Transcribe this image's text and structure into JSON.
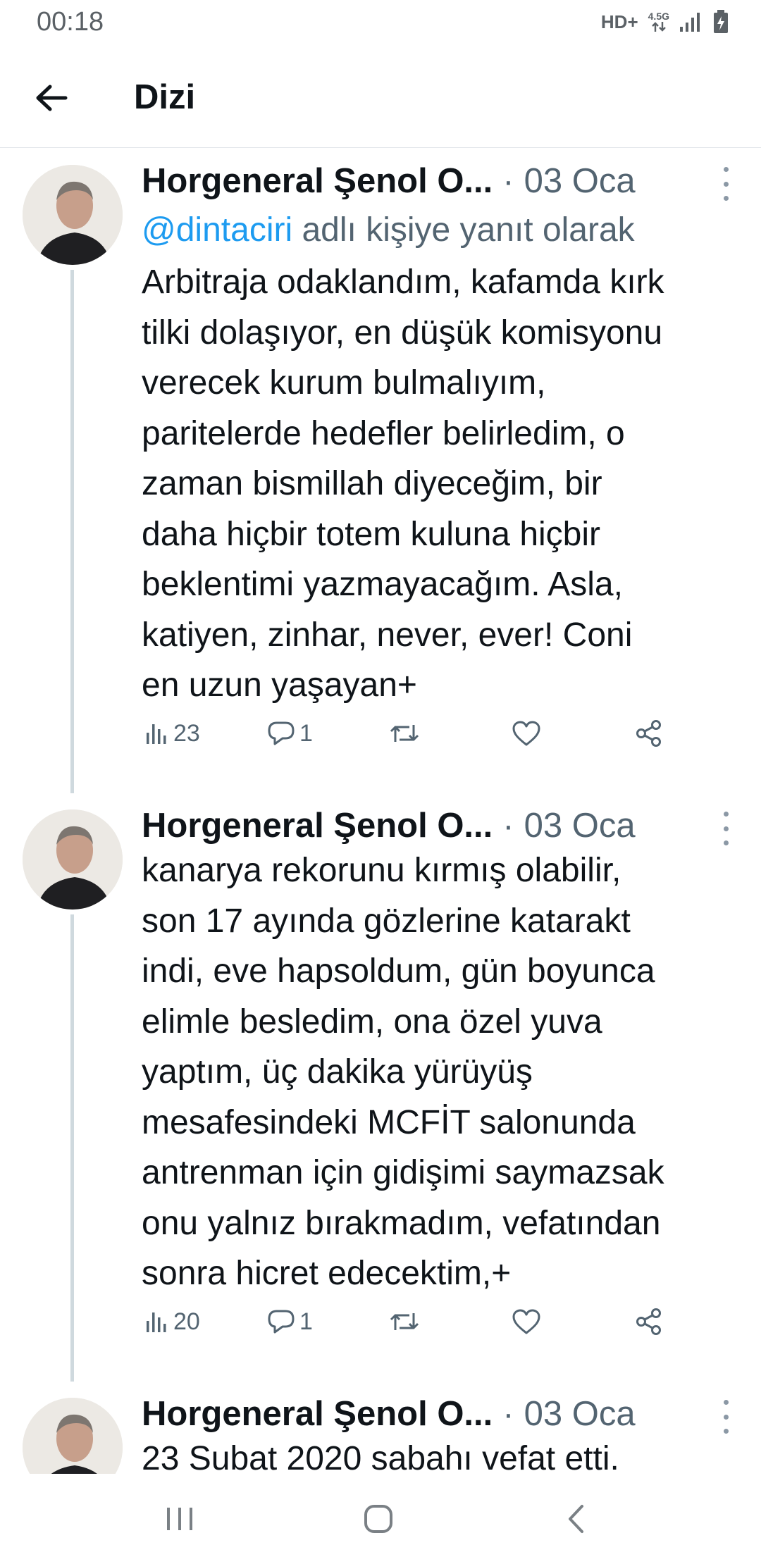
{
  "status_bar": {
    "time": "00:18",
    "hd_label": "HD+",
    "network_label": "4.5G",
    "icons": [
      "data-arrows-icon",
      "signal-icon",
      "battery-icon"
    ]
  },
  "app_bar": {
    "back_icon": "arrow-left-icon",
    "title": "Dizi"
  },
  "tweets": [
    {
      "author": "Horgeneral Şenol O...",
      "separator": "·",
      "date": "03 Oca",
      "reply_to": {
        "handle": "@dintaciri",
        "suffix": " adlı kişiye yanıt olarak"
      },
      "text_lines": [
        "Arbitraja odaklandım, kafamda kırk",
        "tilki dolaşıyor, en düşük komisyonu",
        "verecek kurum bulmalıyım,",
        "paritelerde hedefler belirledim, o",
        "zaman bismillah diyeceğim, bir",
        "daha hiçbir totem kuluna hiçbir",
        "beklentimi yazmayacağım. Asla,",
        "katiyen, zinhar, never, ever! Coni",
        "en uzun yaşayan+"
      ],
      "views": "23",
      "replies": "1"
    },
    {
      "author": "Horgeneral Şenol O...",
      "separator": "·",
      "date": "03 Oca",
      "text_lines": [
        "kanarya rekorunu kırmış olabilir,",
        "son 17 ayında gözlerine katarakt",
        "indi, eve hapsoldum, gün boyunca",
        "elimle besledim, ona özel yuva",
        "yaptım, üç dakika yürüyüş",
        "mesafesindeki MCFİT salonunda",
        "antrenman için gidişimi saymazsak",
        "onu yalnız bırakmadım, vefatından",
        "sonra hicret edecektim,+"
      ],
      "views": "20",
      "replies": "1"
    },
    {
      "author": "Horgeneral Şenol O...",
      "separator": "·",
      "date": "03 Oca",
      "text_lines": [
        "23 Subat 2020 sabahı vefat etti."
      ]
    }
  ],
  "nav_bar": {
    "icons": [
      "recent-apps-icon",
      "home-icon",
      "back-icon"
    ]
  },
  "colors": {
    "text": "#0f1419",
    "muted": "#536471",
    "link": "#1d9bf0",
    "thread_line": "#cfd9de",
    "divider": "#e2e6ea"
  }
}
